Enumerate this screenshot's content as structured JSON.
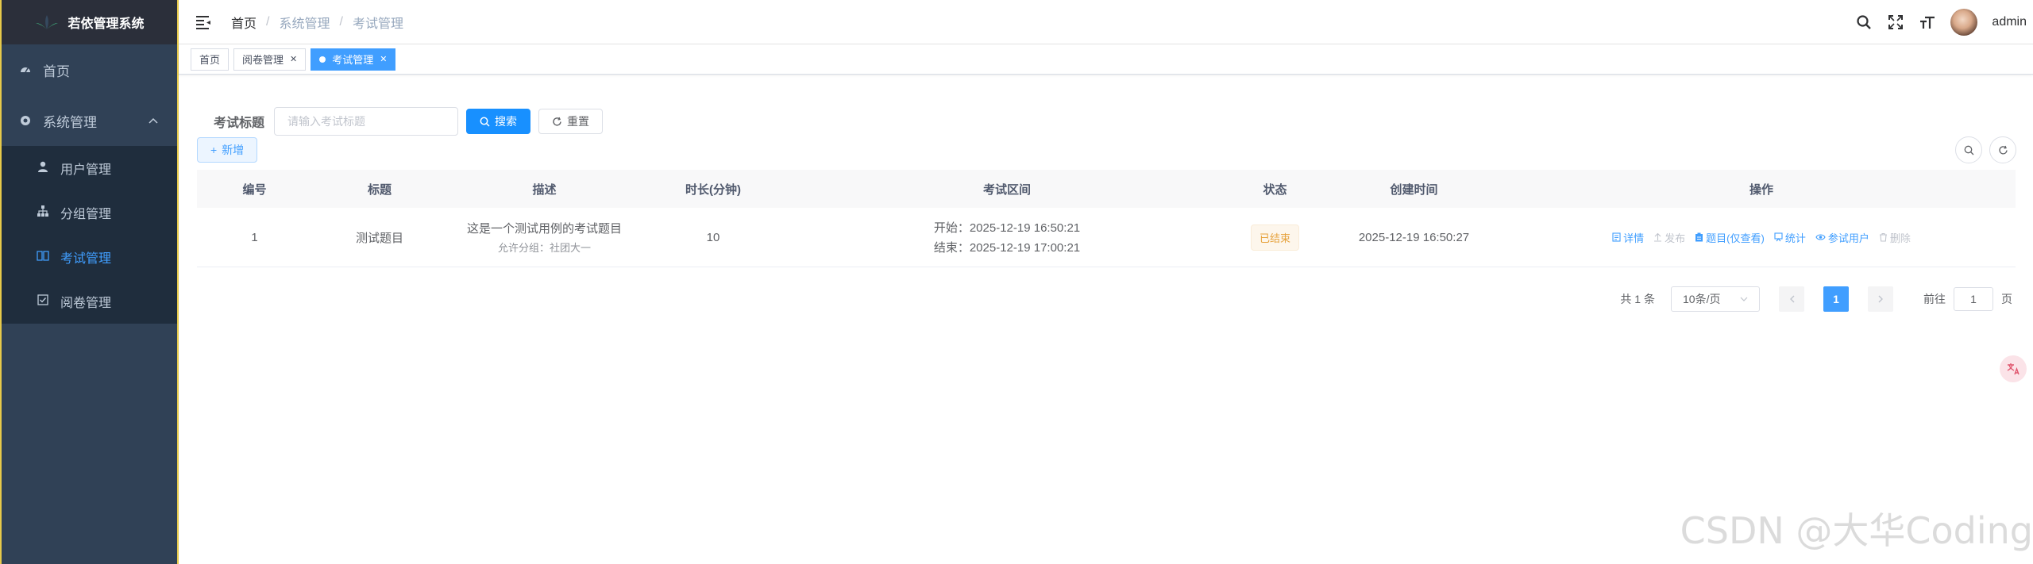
{
  "app": {
    "title": "若依管理系统"
  },
  "sidebar": {
    "items": [
      {
        "label": "首页",
        "icon": "dashboard-icon"
      },
      {
        "label": "系统管理",
        "icon": "gear-icon"
      }
    ],
    "sub_items": [
      {
        "label": "用户管理",
        "icon": "user-icon"
      },
      {
        "label": "分组管理",
        "icon": "tree-icon"
      },
      {
        "label": "考试管理",
        "icon": "book-icon",
        "active": true
      },
      {
        "label": "阅卷管理",
        "icon": "checkbox-icon"
      }
    ]
  },
  "header": {
    "breadcrumb": [
      "首页",
      "系统管理",
      "考试管理"
    ],
    "separator": "/",
    "username": "admin"
  },
  "tags": [
    "首页",
    "阅卷管理",
    "考试管理"
  ],
  "search": {
    "label": "考试标题",
    "placeholder": "请输入考试标题",
    "search_btn": "搜索",
    "reset_btn": "重置"
  },
  "toolbar": {
    "add_btn": "新增"
  },
  "table": {
    "headers": [
      "编号",
      "标题",
      "描述",
      "时长(分钟)",
      "考试区间",
      "状态",
      "创建时间",
      "操作"
    ],
    "rows": [
      {
        "id": "1",
        "title": "测试题目",
        "desc": "这是一个测试用例的考试题目",
        "desc_sub": "允许分组：社团大一",
        "duration": "10",
        "start": "开始：2025-12-19 16:50:21",
        "end": "结束：2025-12-19 17:00:21",
        "status": "已结束",
        "created": "2025-12-19 16:50:27",
        "ops": [
          "详情",
          "发布",
          "题目(仅查看)",
          "统计",
          "参试用户",
          "删除"
        ]
      }
    ]
  },
  "pagination": {
    "total": "共 1 条",
    "page_size": "10条/页",
    "current": "1",
    "goto_prefix": "前往",
    "goto_value": "1",
    "goto_suffix": "页"
  },
  "watermark": "CSDN @大华Coding",
  "colors": {
    "primary": "#1890ff",
    "sidebar_bg": "#304156",
    "active": "#409eff",
    "warning": "#e6a23c"
  }
}
